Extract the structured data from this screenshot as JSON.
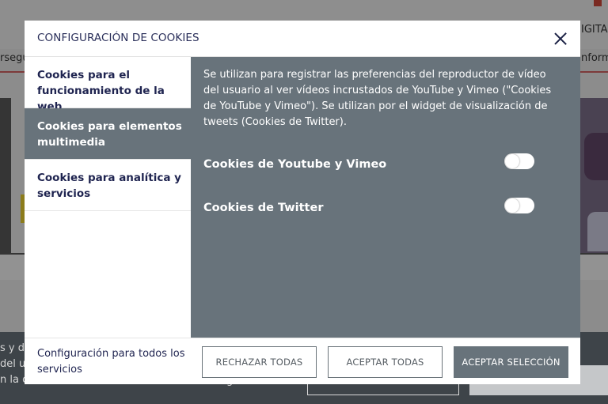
{
  "background": {
    "nav_left_text": "rsegu",
    "nav_right_text": "nform",
    "top_right_text": "IGITAL",
    "footer_lines": [
      "s y d",
      "del u",
      "n la c"
    ],
    "footer_fragment": "g",
    "footer_button_fragment": "s"
  },
  "modal": {
    "title": "CONFIGURACIÓN DE COOKIES",
    "close_label": "Cerrar",
    "tabs": [
      {
        "label": "Cookies para el funcionamiento de la web",
        "active": false
      },
      {
        "label": "Cookies para elementos multimedia",
        "active": true
      },
      {
        "label": "Cookies para analítica y servicios",
        "active": false
      }
    ],
    "panel": {
      "description": "Se utilizan para registrar las preferencias del reproductor de vídeo del usuario al ver vídeos incrustados de YouTube y Vimeo (\"Cookies de YouTube y Vimeo\").  Se utilizan por el widget de visualización de tweets (Cookies de Twitter).",
      "settings": [
        {
          "label": "Cookies de Youtube y Vimeo",
          "enabled": false
        },
        {
          "label": "Cookies de Twitter",
          "enabled": false
        }
      ]
    },
    "footer": {
      "text": "Configuración para todos los servicios",
      "reject_all": "RECHAZAR TODAS",
      "accept_all": "ACEPTAR TODAS",
      "accept_selection": "ACEPTAR SELECCIÓN"
    }
  },
  "colors": {
    "accent": "#68737b",
    "title_navy": "#1f2450",
    "footer_dark": "#3e4449"
  }
}
